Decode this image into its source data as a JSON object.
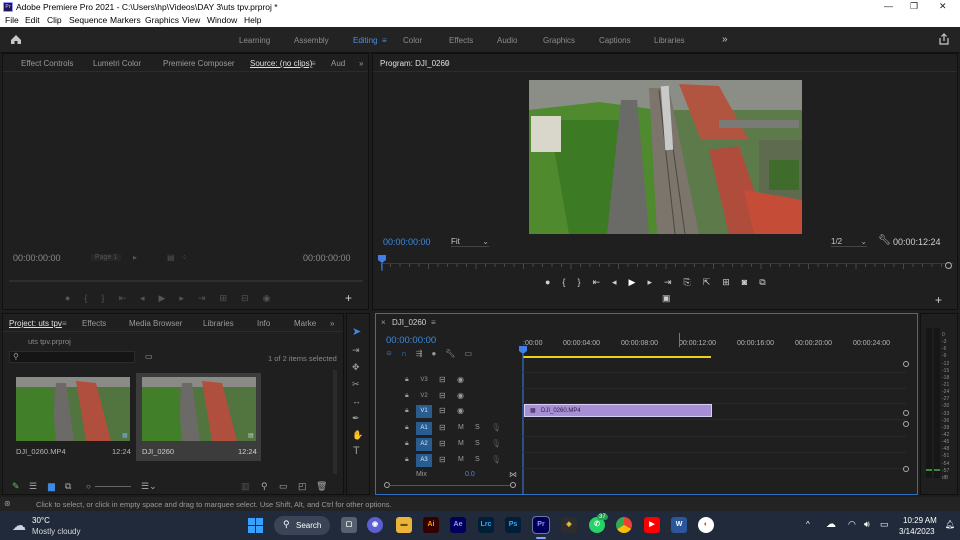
{
  "window": {
    "title": "Adobe Premiere Pro 2021 - C:\\Users\\hp\\Videos\\DAY 3\\uts tpv.prproj *",
    "app_icon": "Pr",
    "controls": {
      "minimize": "—",
      "maximize": "❐",
      "close": "✕"
    }
  },
  "menu": [
    "File",
    "Edit",
    "Clip",
    "Sequence",
    "Markers",
    "Graphics",
    "View",
    "Window",
    "Help"
  ],
  "workspaces": {
    "items": [
      "Learning",
      "Assembly",
      "Editing",
      "Color",
      "Effects",
      "Audio",
      "Graphics",
      "Captions",
      "Libraries"
    ],
    "active": "Editing",
    "more": "»"
  },
  "source_panel": {
    "tabs": [
      "Effect Controls",
      "Lumetri Color",
      "Premiere Composer",
      "Source: (no clips)",
      "Aud"
    ],
    "active_tab": "Source: (no clips)",
    "timecode_left": "00:00:00:00",
    "page": "Page 1",
    "timecode_right": "00:00:00:00"
  },
  "program_panel": {
    "title": "Program: DJI_0260",
    "timecode": "00:00:00:00",
    "fit": "Fit",
    "resolution": "1/2",
    "duration": "00:00:12:24"
  },
  "project_panel": {
    "tabs": [
      "Project: uts tpv",
      "Effects",
      "Media Browser",
      "Libraries",
      "Info",
      "Marke"
    ],
    "active_tab": "Project: uts tpv",
    "project_file": "uts tpv.prproj",
    "items_selected": "1 of 2 items selected",
    "items": [
      {
        "name": "DJI_0260.MP4",
        "duration": "12:24",
        "selected": false
      },
      {
        "name": "DJI_0260",
        "duration": "12:24",
        "selected": true
      }
    ]
  },
  "timeline": {
    "sequence_tab": "DJI_0260",
    "timecode": "00:00:00:00",
    "ruler": [
      ":00:00",
      "00:00:04:00",
      "00:00:08:00",
      "00:00:12:00",
      "00:00:16:00",
      "00:00:20:00",
      "00:00:24:00"
    ],
    "video_tracks": [
      "V3",
      "V2",
      "V1"
    ],
    "audio_tracks": [
      "A1",
      "A2",
      "A3"
    ],
    "track_controls": {
      "mute": "M",
      "solo": "S"
    },
    "mix_label": "Mix",
    "mix_value": "0.0",
    "clip_label": "DJI_0260.MP4",
    "clip_end_seconds": 12.96,
    "ruler_max_seconds": 26
  },
  "audio_meter": {
    "scale": [
      "0",
      "-3",
      "-6",
      "-9",
      "-12",
      "-15",
      "-18",
      "-21",
      "-24",
      "-27",
      "-30",
      "-33",
      "-36",
      "-39",
      "-42",
      "-45",
      "-48",
      "-51",
      "-54",
      "-57",
      "dB"
    ]
  },
  "status_bar": {
    "text": "Click to select, or click in empty space and drag to marquee select. Use Shift, Alt, and Ctrl for other options."
  },
  "taskbar": {
    "weather_temp": "30°C",
    "weather_desc": "Mostly cloudy",
    "search_label": "Search",
    "apps": [
      "Ai",
      "Ae",
      "Lrc",
      "Ps",
      "Pr"
    ],
    "whatsapp_badge": "37",
    "time": "10:29 AM",
    "date": "3/14/2023"
  },
  "colors": {
    "accent_blue": "#3d8ae0",
    "clip_purple": "#a78fd6",
    "playhead": "#3f7fe6",
    "track_selected": "#2a5d8f"
  }
}
